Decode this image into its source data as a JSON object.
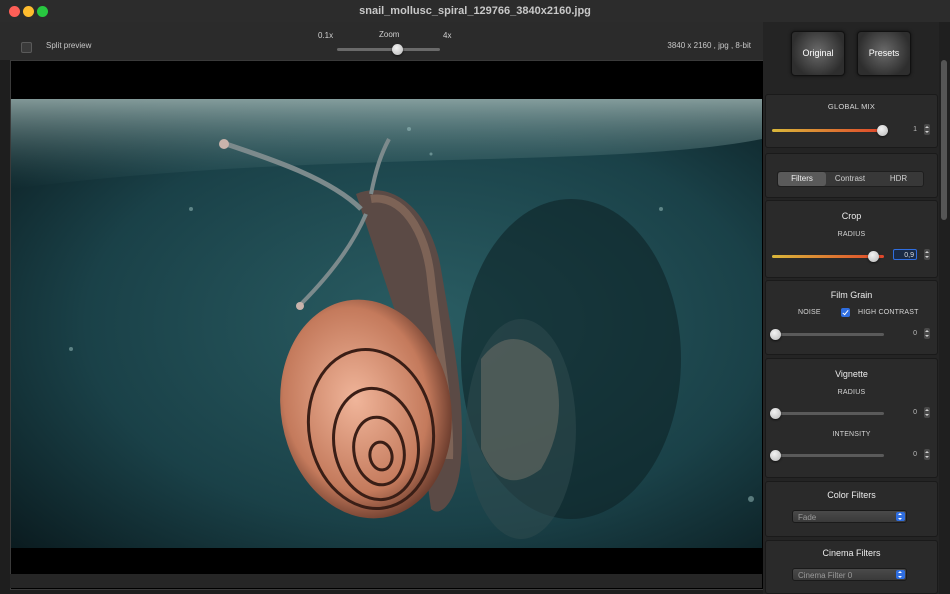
{
  "window": {
    "title": "snail_mollusc_spiral_129766_3840x2160.jpg"
  },
  "toolbar": {
    "split_preview_label": "Split preview",
    "zoom_min": "0.1x",
    "zoom_label": "Zoom",
    "zoom_max": "4x",
    "image_info": "3840 x 2160 , jpg , 8-bit"
  },
  "buttons": {
    "original": "Original",
    "presets": "Presets"
  },
  "global_mix": {
    "title": "GLOBAL MIX",
    "value": "1"
  },
  "tabs": [
    "Filters",
    "Contrast",
    "HDR"
  ],
  "crop": {
    "title": "Crop",
    "radius_label": "RADIUS",
    "radius_value": "0,9"
  },
  "film_grain": {
    "title": "Film Grain",
    "noise_label": "NOISE",
    "high_contrast_label": "HIGH CONTRAST",
    "value": "0"
  },
  "vignette": {
    "title": "Vignette",
    "radius_label": "RADIUS",
    "radius_value": "0",
    "intensity_label": "INTENSITY",
    "intensity_value": "0"
  },
  "color_filters": {
    "title": "Color Filters",
    "selected": "Fade"
  },
  "cinema_filters": {
    "title": "Cinema Filters",
    "selected": "Cinema Filter 0"
  },
  "colors": {
    "accent_blue": "#2f6ee0",
    "track_gradient_start": "#d9b73a",
    "track_gradient_end": "#e0452a"
  }
}
